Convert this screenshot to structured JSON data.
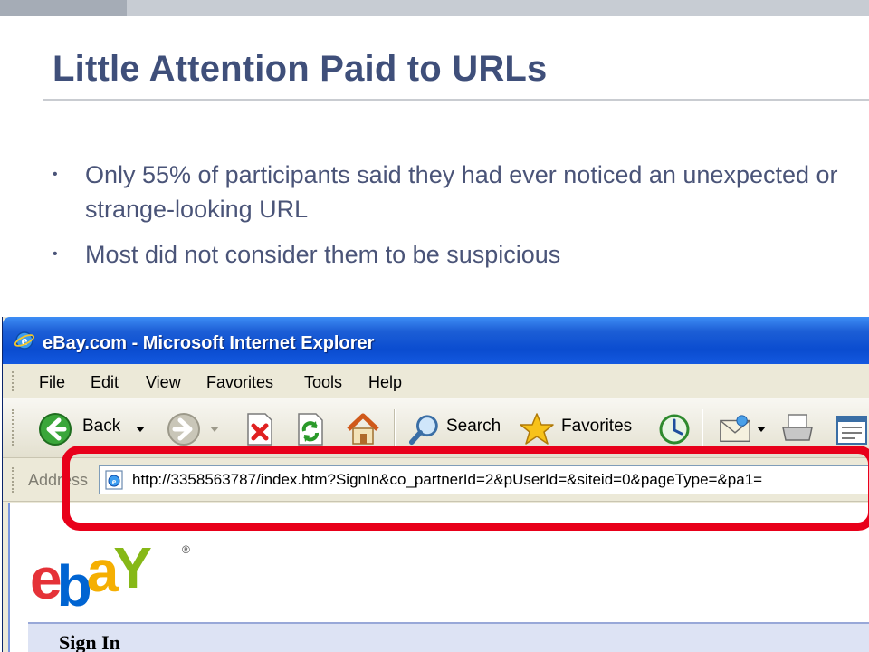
{
  "slide": {
    "title": "Little Attention Paid to URLs",
    "bullets": [
      "Only 55% of participants said they had ever noticed an unexpected or strange-looking URL",
      "Most did not consider them to be suspicious"
    ],
    "bullet_glyph": "•"
  },
  "browser": {
    "window_title": "eBay.com - Microsoft Internet Explorer",
    "menu": [
      "File",
      "Edit",
      "View",
      "Favorites",
      "Tools",
      "Help"
    ],
    "toolbar": {
      "back_label": "Back",
      "search_label": "Search",
      "favorites_label": "Favorites"
    },
    "address": {
      "label": "Address",
      "url": "http://3358563787/index.htm?SignIn&co_partnerId=2&pUserId=&siteid=0&pageType=&pa1="
    },
    "page": {
      "logo_text": "ebaY",
      "logo_mark": "®",
      "signin_title": "Sign In"
    },
    "highlight_color": "#e8001a"
  },
  "colors": {
    "title": "#3f4f7a",
    "bullet_text": "#4a5478",
    "xp_titlebar": "#0a4cd0"
  }
}
